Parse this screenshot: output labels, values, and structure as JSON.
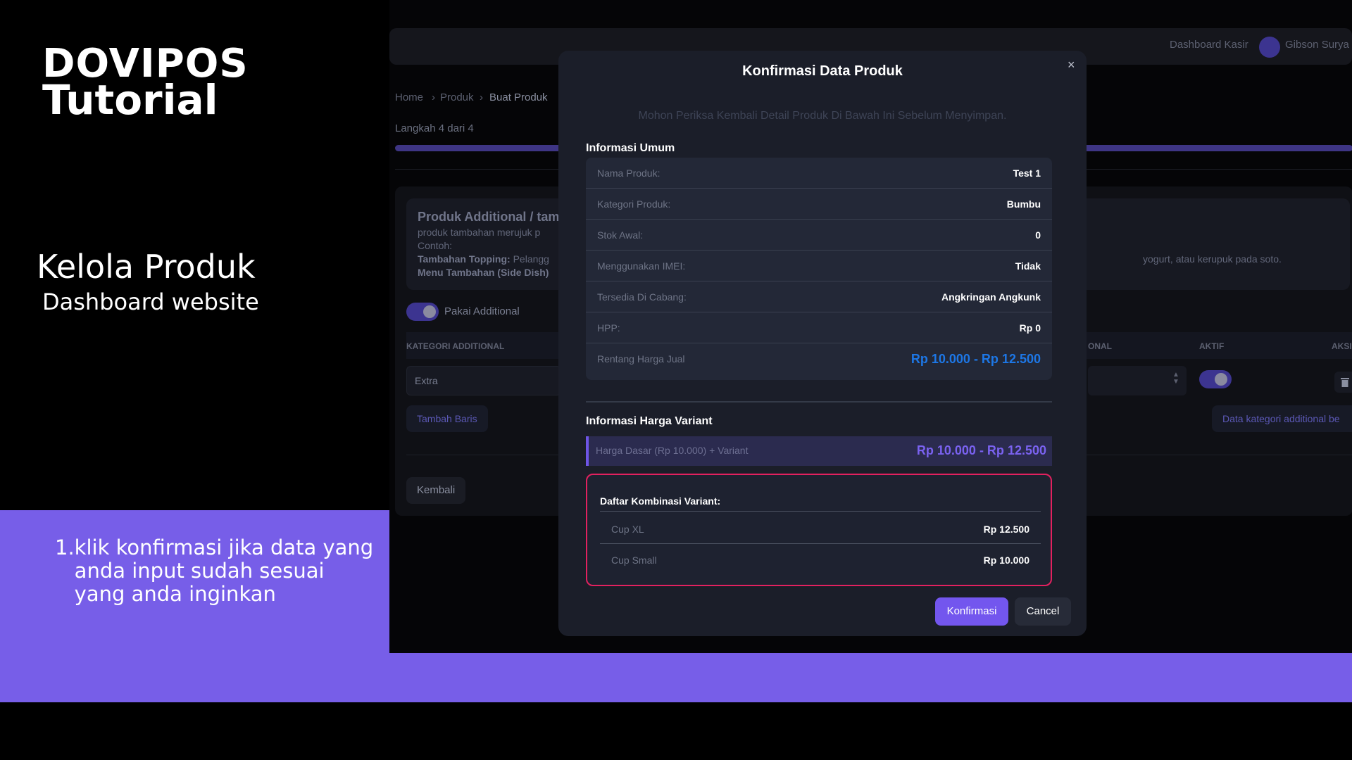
{
  "tutorial": {
    "brand_line1": "DOVIPOS",
    "brand_line2": "Tutorial",
    "section_title": "Kelola Produk",
    "section_subtitle": "Dashboard website",
    "instruction_number": "1.",
    "instruction_text": "klik konfirmasi jika data yang anda input sudah sesuai yang anda inginkan"
  },
  "background_app": {
    "topbar_kasir": "Dashboard Kasir",
    "topbar_user": "Gibson Surya",
    "breadcrumb": [
      "Home",
      "Produk",
      "Buat Produk"
    ],
    "breadcrumb_sep": "›",
    "step_text": "Langkah 4 dari 4",
    "additional_title": "Produk Additional / tamb",
    "additional_desc": "produk tambahan merujuk p",
    "additional_example": "Contoh:",
    "topping_label": "Tambahan Topping:",
    "topping_text": "Pelangg",
    "side_dish_label": "Menu Tambahan (Side Dish)",
    "right_desc": "yogurt, atau kerupuk pada soto.",
    "toggle_label": "Pakai Additional",
    "col_kategori": "KATEGORI ADDITIONAL",
    "col_onal": "ONAL",
    "col_aktif": "AKTIF",
    "col_aksi": "AKSI",
    "row_kategori_value": "Extra",
    "add_row_button": "Tambah Baris",
    "data_kategori_button": "Data kategori additional be",
    "back_button": "Kembali"
  },
  "modal": {
    "title": "Konfirmasi Data Produk",
    "close_symbol": "×",
    "subtitle": "Mohon Periksa Kembali Detail Produk Di Bawah Ini Sebelum Menyimpan.",
    "general_heading": "Informasi Umum",
    "rows": [
      {
        "label": "Nama Produk:",
        "value": "Test 1"
      },
      {
        "label": "Kategori Produk:",
        "value": "Bumbu"
      },
      {
        "label": "Stok Awal:",
        "value": "0"
      },
      {
        "label": "Menggunakan IMEI:",
        "value": "Tidak"
      },
      {
        "label": "Tersedia Di Cabang:",
        "value": "Angkringan Angkunk"
      },
      {
        "label": "HPP:",
        "value": "Rp 0"
      },
      {
        "label": "Rentang Harga Jual",
        "value": "Rp 10.000 - Rp 12.500"
      }
    ],
    "variant_heading": "Informasi Harga Variant",
    "variant_base_label": "Harga Dasar (Rp 10.000) + Variant",
    "variant_base_value": "Rp 10.000 - Rp 12.500",
    "combo_title": "Daftar Kombinasi Variant:",
    "combos": [
      {
        "label": "Cup XL",
        "value": "Rp 12.500"
      },
      {
        "label": "Cup Small",
        "value": "Rp 10.000"
      }
    ],
    "confirm_button": "Konfirmasi",
    "cancel_button": "Cancel"
  },
  "colors": {
    "accent_purple": "#775ee8",
    "confirm_button": "#7356ee",
    "price_blue": "#1d77e6",
    "combo_border": "#e2215f"
  }
}
